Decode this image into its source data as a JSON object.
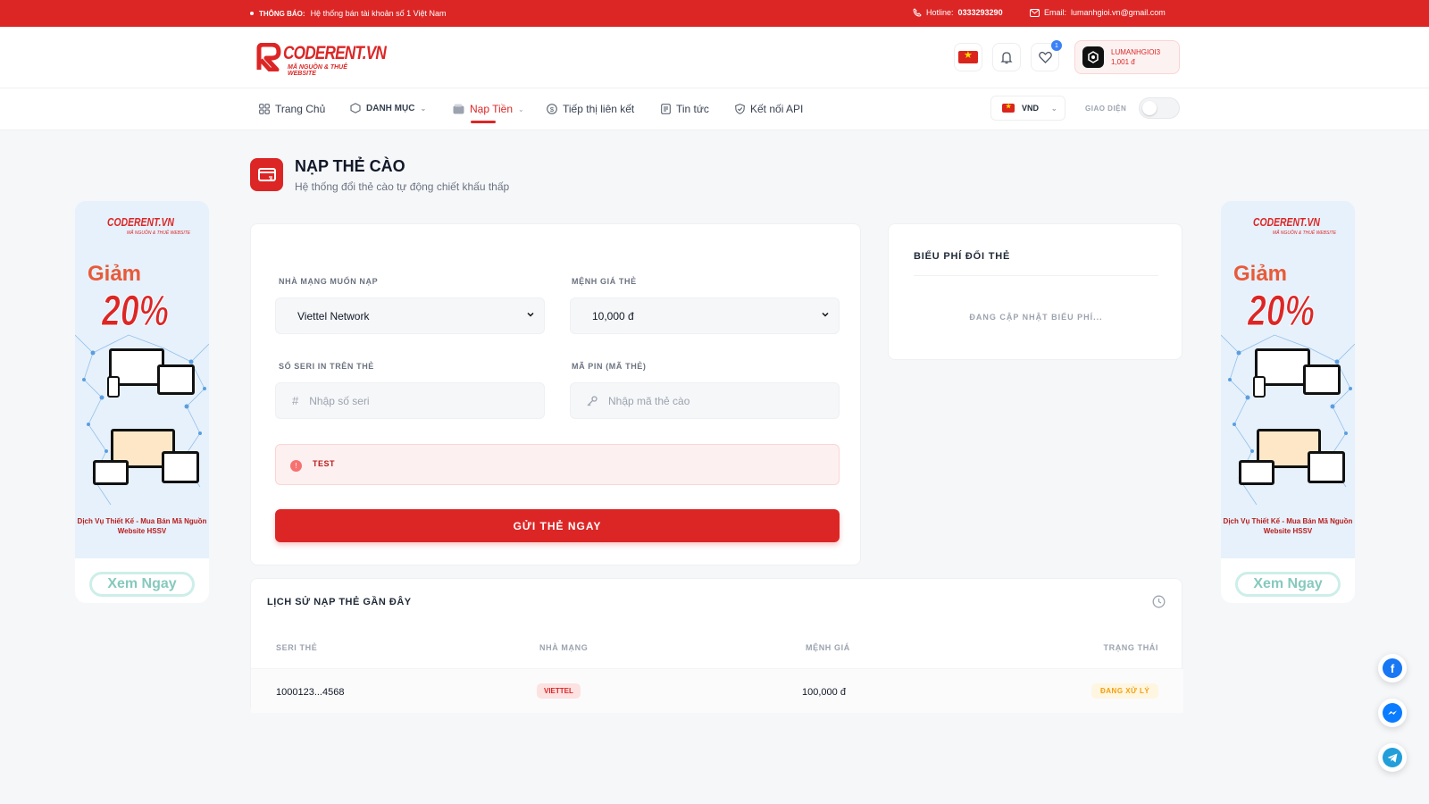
{
  "topbar": {
    "notice_label": "THÔNG BÁO:",
    "notice_text": "Hệ thống bán tài khoản số 1 Việt Nam",
    "hotline_label": "Hotline:",
    "hotline": "0333293290",
    "email_label": "Email:",
    "email": "lumanhgioi.vn@gmail.com"
  },
  "header": {
    "logo_text": "CODERENT.VN",
    "logo_sub": "MÃ NGUỒN & THUÊ WEBSITE",
    "wishlist_count": "1",
    "user_name": "LUMANHGIOI3",
    "user_balance": "1,001 đ"
  },
  "nav": {
    "items": [
      "Trang Chủ",
      "DANH MỤC",
      "Nạp Tiền",
      "Tiếp thị liên kết",
      "Tin tức",
      "Kết nối API"
    ],
    "currency": "VND",
    "theme_label": "GIAO DIỆN"
  },
  "page": {
    "title": "NẠP THẺ CÀO",
    "subtitle": "Hệ thống đổi thẻ cào tự động chiết khấu thấp"
  },
  "form": {
    "network_label": "NHÀ MẠNG MUỐN NẠP",
    "network_value": "Viettel Network",
    "amount_label": "MỆNH GIÁ THẺ",
    "amount_value": "10,000 đ",
    "serial_label": "SỐ SERI IN TRÊN THẺ",
    "serial_placeholder": "Nhập số seri",
    "pin_label": "MÃ PIN (MÃ THẺ)",
    "pin_placeholder": "Nhập mã thẻ cào",
    "alert_text": "TEST",
    "submit_label": "GỬI THẺ NGAY"
  },
  "fees": {
    "title": "BIỂU PHÍ ĐỔI THẺ",
    "updating": "ĐANG CẬP NHẬT BIỂU PHÍ..."
  },
  "history": {
    "title": "LỊCH SỬ NẠP THẺ GẦN ĐÂY",
    "columns": [
      "SERI THẺ",
      "NHÀ MẠNG",
      "MỆNH GIÁ",
      "TRẠNG THÁI"
    ],
    "rows": [
      {
        "serial": "1000123...4568",
        "network": "VIETTEL",
        "amount": "100,000 đ",
        "status": "ĐANG XỬ LÝ"
      }
    ]
  },
  "banner": {
    "logo": "CODERENT.VN",
    "logo_sub": "MÃ NGUỒN & THUÊ WEBSITE",
    "discount_word": "Giảm",
    "discount_value": "20%",
    "description": "Dịch Vụ Thiết Kế - Mua Bán Mã Nguồn Website HSSV",
    "button": "Xem Ngay"
  },
  "colors": {
    "brand": "#dc2626",
    "warning": "#f59e0b",
    "facebook": "#1877f2",
    "messenger": "#0a7cff",
    "telegram": "#229ed9"
  },
  "social_icons": [
    "facebook-icon",
    "messenger-icon",
    "telegram-icon"
  ]
}
